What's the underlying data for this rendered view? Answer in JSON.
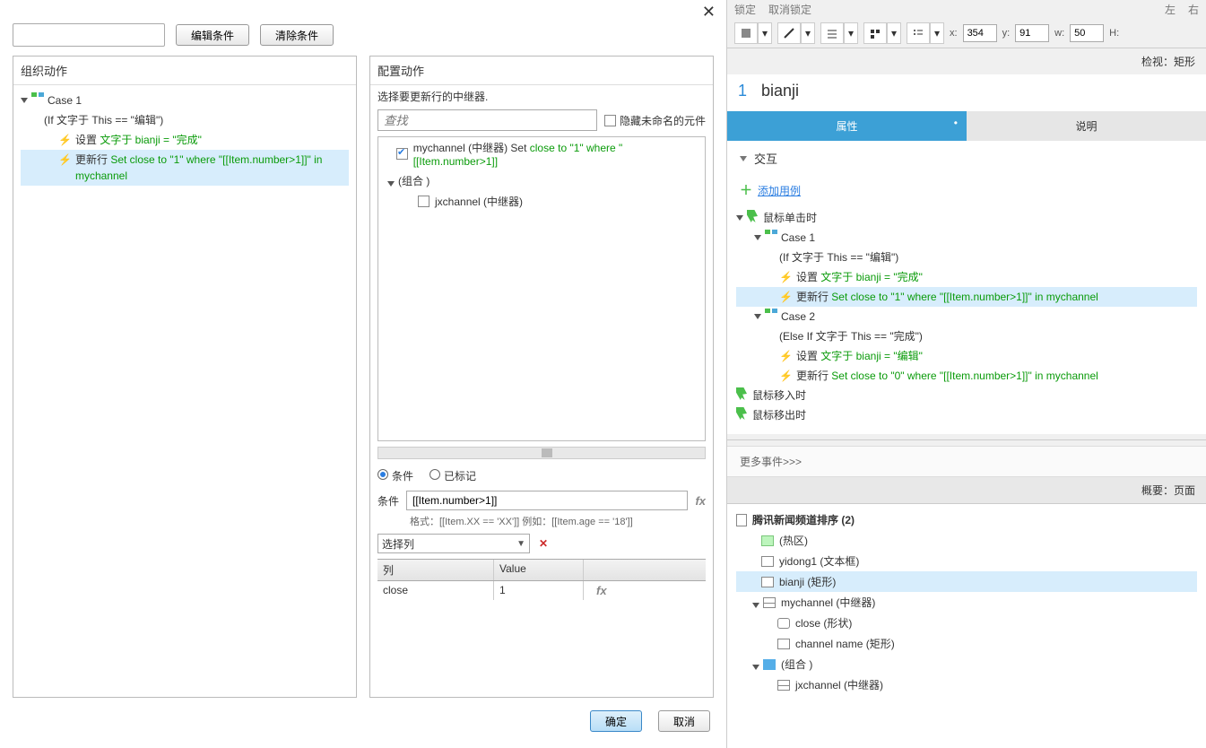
{
  "dialog": {
    "edit_condition_btn": "编辑条件",
    "clear_condition_btn": "清除条件",
    "org_actions_title": "组织动作",
    "config_action_title": "配置动作",
    "case1_label": "Case 1",
    "case1_cond": "(If 文字于 This == \"编辑\")",
    "set_text_prefix": "设置",
    "set_text_green": "文字于 bianji = \"完成\"",
    "update_row_prefix": "更新行",
    "update_row_green": "Set close to \"1\" where \"[[Item.number>1]]\" in mychannel",
    "select_repeater_label": "选择要更新行的中继器.",
    "search_placeholder": "查找",
    "hide_unnamed_label": "隐藏未命名的元件",
    "mychannel_label": "mychannel (中继器) Set",
    "mychannel_green": "close to \"1\" where \"[[Item.number>1]]",
    "group_label": "(组合 )",
    "jxchannel_label": "jxchannel (中继器)",
    "radio_condition": "条件",
    "radio_marked": "已标记",
    "condition_label": "条件",
    "condition_value": "[[Item.number>1]]",
    "hint_text": "格式：[[Item.XX == 'XX']] 例如：[[Item.age == '18']]",
    "select_col_label": "选择列",
    "col_header": "列",
    "val_header": "Value",
    "col_cell": "close",
    "val_cell": "1",
    "ok_btn": "确定",
    "cancel_btn": "取消"
  },
  "toolbar": {
    "lock": "锁定",
    "unlock": "取消锁定",
    "left": "左",
    "right": "右",
    "x_lbl": "x:",
    "x_val": "354",
    "y_lbl": "y:",
    "y_val": "91",
    "w_lbl": "w:",
    "w_val": "50",
    "h_lbl": "H:"
  },
  "inspect": {
    "title": "检视：矩形",
    "idx": "1",
    "name": "bianji",
    "tab_props": "属性",
    "tab_notes": "说明",
    "interaction_title": "交互",
    "add_case": "添加用例",
    "mouse_click": "鼠标单击时",
    "case1": "Case 1",
    "case1_cond": "(If 文字于 This == \"编辑\")",
    "set_text1": "文字于 bianji = \"完成\"",
    "update1": "Set close to \"1\" where \"[[Item.number>1]]\" in mychannel",
    "case2": "Case 2",
    "case2_cond": "(Else If 文字于 This == \"完成\")",
    "set_text2": "文字于 bianji = \"编辑\"",
    "update2": "Set close to \"0\" where \"[[Item.number>1]]\" in mychannel",
    "mouse_in": "鼠标移入时",
    "mouse_out": "鼠标移出时",
    "more_ev": "更多事件>>>"
  },
  "outline": {
    "title": "概要：页面",
    "root": "腾讯新闻频道排序 (2)",
    "hot": "(热区)",
    "yidong": "yidong1 (文本框)",
    "bianji": "bianji (矩形)",
    "mychannel": "mychannel (中继器)",
    "close": "close (形状)",
    "channel": "channel name (矩形)",
    "group": "(组合 )",
    "jxchannel": "jxchannel (中继器)"
  }
}
